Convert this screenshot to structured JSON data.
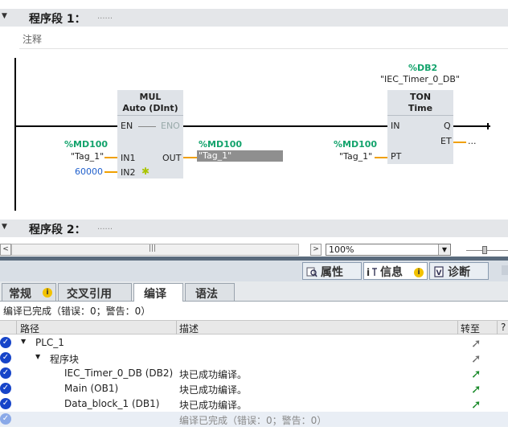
{
  "segment1": {
    "title": "程序段 1：",
    "dots": "......",
    "comment": "注释"
  },
  "segment2": {
    "title": "程序段 2：",
    "dots": "......"
  },
  "mul_block": {
    "name": "MUL",
    "type": "Auto (DInt)",
    "en": "EN",
    "eno": "ENO",
    "in1": "IN1",
    "in2": "IN2",
    "out": "OUT",
    "in1_addr": "%MD100",
    "in1_tag": "\"Tag_1\"",
    "in2_value": "60000",
    "out_addr": "%MD100",
    "out_tag": "\"Tag_1\""
  },
  "ton_block": {
    "db_addr": "%DB2",
    "db_name": "\"IEC_Timer_0_DB\"",
    "name": "TON",
    "type": "Time",
    "in": "IN",
    "q": "Q",
    "pt": "PT",
    "et": "ET",
    "et_value": "...",
    "pt_addr": "%MD100",
    "pt_tag": "\"Tag_1\""
  },
  "toolbar": {
    "zoom": "100%",
    "scroll_mark": "|||"
  },
  "pane_tabs": [
    {
      "label": "属性",
      "icon": "properties-icon"
    },
    {
      "label": "信息",
      "icon": "info-icon"
    },
    {
      "label": "诊断",
      "icon": "diagnostics-icon"
    }
  ],
  "sub_tabs": [
    {
      "label": "常规"
    },
    {
      "label": "交叉引用"
    },
    {
      "label": "编译"
    },
    {
      "label": "语法"
    }
  ],
  "status_text": "编译已完成（错误：0；警告：0）",
  "table": {
    "headers": {
      "path": "路径",
      "desc": "描述",
      "goto": "转至",
      "help": "?"
    },
    "rows": [
      {
        "path": "PLC_1",
        "desc": ""
      },
      {
        "path": "程序块",
        "desc": ""
      },
      {
        "path": "IEC_Timer_0_DB (DB2)",
        "desc": "块已成功编译。"
      },
      {
        "path": "Main (OB1)",
        "desc": "块已成功编译。"
      },
      {
        "path": "Data_block_1 (DB1)",
        "desc": "块已成功编译。"
      },
      {
        "path": "",
        "desc": "编译已完成（错误：0；警告：0）"
      }
    ]
  },
  "colors": {
    "address_green": "#13a36c",
    "constant_blue": "#1f5fcc",
    "wire_orange": "#f0a000",
    "check_blue": "#1745c9",
    "goto_green": "#1a8a2a"
  }
}
